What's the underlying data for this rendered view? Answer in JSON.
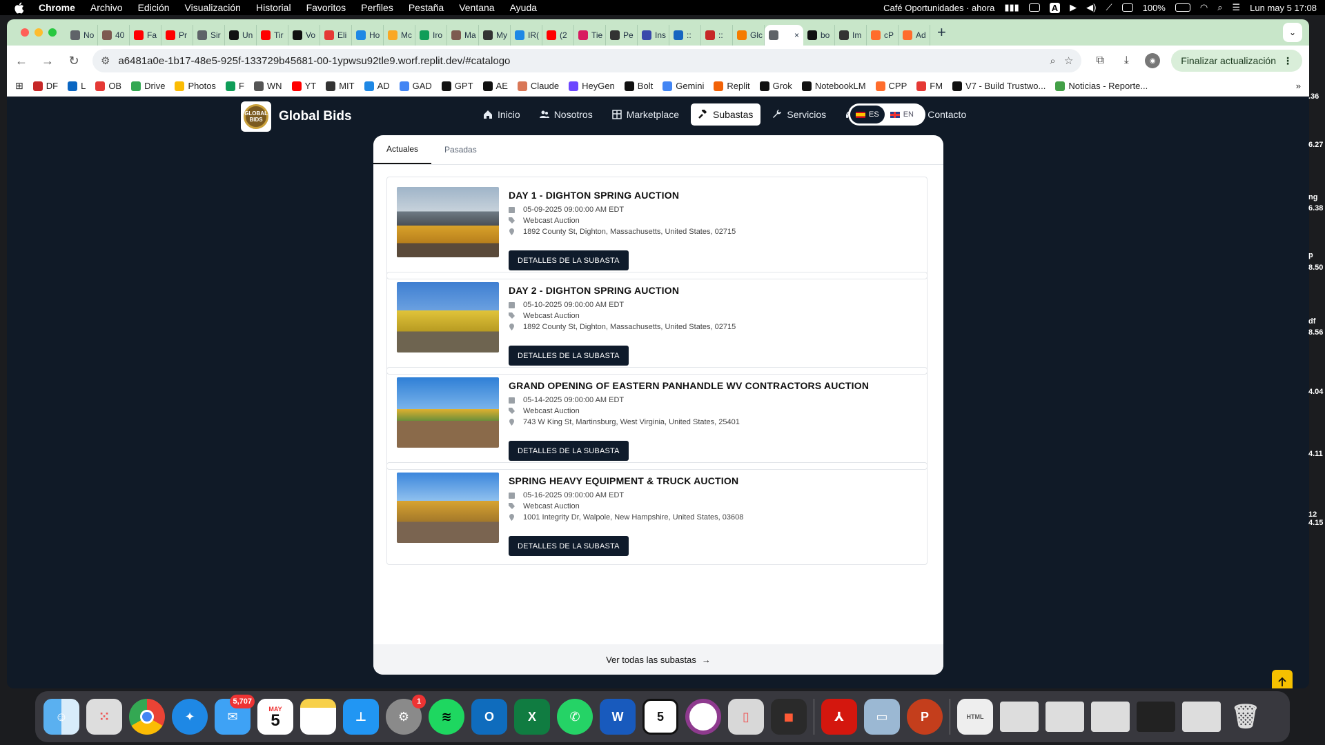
{
  "menubar": {
    "app": "Chrome",
    "menus": [
      "Archivo",
      "Edición",
      "Visualización",
      "Historial",
      "Favoritos",
      "Perfiles",
      "Pestaña",
      "Ventana",
      "Ayuda"
    ],
    "notification": "Café Oportunidades · ahora",
    "battery": "100%",
    "datetime": "Lun may 5  17:08"
  },
  "tabs": [
    {
      "label": "No",
      "color": "#5f6368"
    },
    {
      "label": "40",
      "color": "#7d5a50"
    },
    {
      "label": "Fa",
      "color": "#ff0000"
    },
    {
      "label": "Pr",
      "color": "#ff0000"
    },
    {
      "label": "Sir",
      "color": "#5f6368"
    },
    {
      "label": "Un",
      "color": "#111111"
    },
    {
      "label": "Tir",
      "color": "#ff0000"
    },
    {
      "label": "Vo",
      "color": "#111111"
    },
    {
      "label": "Eli",
      "color": "#e53935"
    },
    {
      "label": "Ho",
      "color": "#1e88e5"
    },
    {
      "label": "Mc",
      "color": "#f9a825"
    },
    {
      "label": "Iro",
      "color": "#0f9d58"
    },
    {
      "label": "Ma",
      "color": "#7d5a50"
    },
    {
      "label": "My",
      "color": "#333333"
    },
    {
      "label": "IR(",
      "color": "#1e88e5"
    },
    {
      "label": "(2",
      "color": "#ff0000"
    },
    {
      "label": "Tie",
      "color": "#d81b60"
    },
    {
      "label": "Pe",
      "color": "#333333"
    },
    {
      "label": "Ins",
      "color": "#3949ab"
    },
    {
      "label": "::",
      "color": "#1565c0"
    },
    {
      "label": "::",
      "color": "#c62828"
    },
    {
      "label": "Glc",
      "color": "#f57c00"
    },
    {
      "label": "",
      "color": "#5f6368",
      "active": true
    },
    {
      "label": "bo",
      "color": "#111111"
    },
    {
      "label": "Im",
      "color": "#333333"
    },
    {
      "label": "cP",
      "color": "#ff6c2c"
    },
    {
      "label": "Ad",
      "color": "#ff6c2c"
    }
  ],
  "toolbar": {
    "url": "a6481a0e-1b17-48e5-925f-133729b45681-00-1ypwsu92tle9.worf.replit.dev/#catalogo",
    "update_label": "Finalizar actualización"
  },
  "bookmarks": [
    {
      "label": "DF",
      "color": "#c62828"
    },
    {
      "label": "L",
      "color": "#0a66c2"
    },
    {
      "label": "OB",
      "color": "#e53935"
    },
    {
      "label": "Drive",
      "color": "#34a853"
    },
    {
      "label": "Photos",
      "color": "#fbbc04"
    },
    {
      "label": "F",
      "color": "#0f9d58"
    },
    {
      "label": "WN",
      "color": "#555555"
    },
    {
      "label": "YT",
      "color": "#ff0000"
    },
    {
      "label": "MIT",
      "color": "#333333"
    },
    {
      "label": "AD",
      "color": "#1e88e5"
    },
    {
      "label": "GAD",
      "color": "#4285f4"
    },
    {
      "label": "GPT",
      "color": "#111111"
    },
    {
      "label": "AE",
      "color": "#111111"
    },
    {
      "label": "Claude",
      "color": "#d97757"
    },
    {
      "label": "HeyGen",
      "color": "#6c47ff"
    },
    {
      "label": "Bolt",
      "color": "#111111"
    },
    {
      "label": "Gemini",
      "color": "#4285f4"
    },
    {
      "label": "Replit",
      "color": "#f26207"
    },
    {
      "label": "Grok",
      "color": "#111111"
    },
    {
      "label": "NotebookLM",
      "color": "#111111"
    },
    {
      "label": "CPP",
      "color": "#ff6c2c"
    },
    {
      "label": "FM",
      "color": "#e53935"
    },
    {
      "label": "V7 - Build Trustwo...",
      "color": "#111111"
    },
    {
      "label": "Noticias - Reporte...",
      "color": "#43a047"
    }
  ],
  "site": {
    "brand": "Global Bids",
    "logo_text": "GLOBAL BIDS",
    "nav": [
      {
        "label": "Inicio",
        "icon": "home-icon"
      },
      {
        "label": "Nosotros",
        "icon": "users-icon"
      },
      {
        "label": "Marketplace",
        "icon": "grid-icon"
      },
      {
        "label": "Subastas",
        "icon": "gavel-icon",
        "active": true
      },
      {
        "label": "Servicios",
        "icon": "wrench-icon"
      },
      {
        "label": "Soporte",
        "icon": "headset-icon"
      },
      {
        "label": "Contacto",
        "icon": "envelope-icon"
      }
    ],
    "lang": {
      "es": "ES",
      "en": "EN"
    }
  },
  "catalog": {
    "tabs": [
      "Actuales",
      "Pasadas"
    ],
    "button_label": "DETALLES DE LA SUBASTA",
    "see_all": "Ver todas las subastas",
    "auctions": [
      {
        "title": "DAY 1 - DIGHTON SPRING AUCTION",
        "date": "05-09-2025 09:00:00 AM EDT",
        "type": "Webcast Auction",
        "address": "1892 County St, Dighton, Massachusetts, United States, 02715"
      },
      {
        "title": "DAY 2 - DIGHTON SPRING AUCTION",
        "date": "05-10-2025 09:00:00 AM EDT",
        "type": "Webcast Auction",
        "address": "1892 County St, Dighton, Massachusetts, United States, 02715"
      },
      {
        "title": "GRAND OPENING OF EASTERN PANHANDLE WV CONTRACTORS AUCTION",
        "date": "05-14-2025 09:00:00 AM EDT",
        "type": "Webcast Auction",
        "address": "743 W King St, Martinsburg, West Virginia, United States, 25401"
      },
      {
        "title": "SPRING HEAVY EQUIPMENT & TRUCK AUCTION",
        "date": "05-16-2025 09:00:00 AM EDT",
        "type": "Webcast Auction",
        "address": "1001 Integrity Dr, Walpole, New Hampshire, United States, 03608"
      }
    ]
  },
  "side_fragments": [
    ".36",
    "6.27",
    "ng",
    "6.38",
    "p",
    "8.50",
    "df",
    "8.56",
    "4.04",
    "4.11",
    "12",
    "4.15"
  ],
  "dock": {
    "mail_badge": "5,707",
    "calendar_month": "MAY",
    "calendar_day": "5",
    "settings_badge": "1",
    "app5_label": "5"
  }
}
